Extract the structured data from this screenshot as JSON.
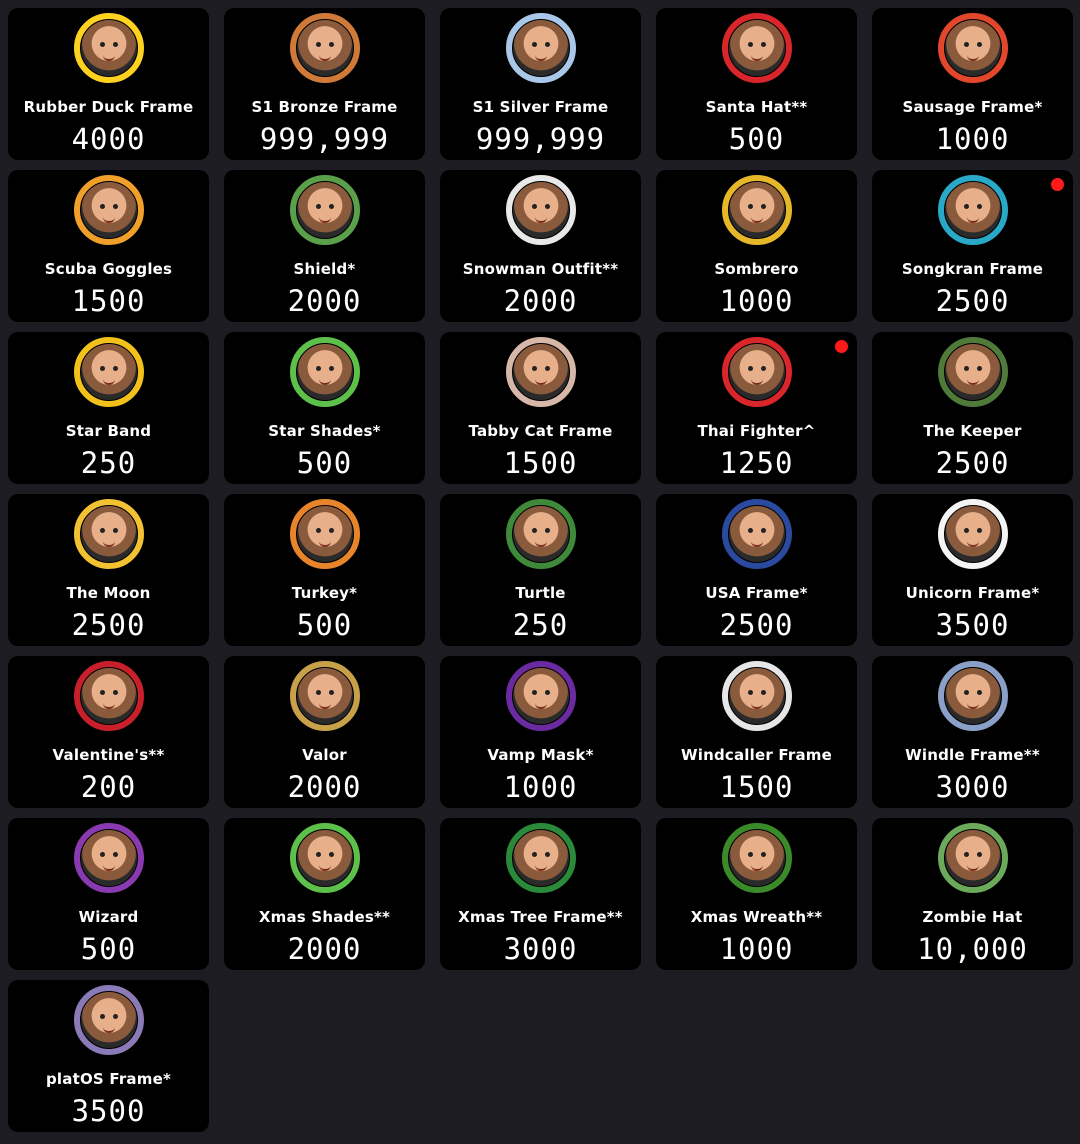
{
  "items": [
    {
      "name": "Rubber Duck Frame",
      "price": "4000",
      "icon": "rubber-duck-frame-icon",
      "ring": "#ffd21f",
      "badge": false
    },
    {
      "name": "S1 Bronze Frame",
      "price": "999,999",
      "icon": "bronze-frame-icon",
      "ring": "#d07a3a",
      "badge": false
    },
    {
      "name": "S1 Silver Frame",
      "price": "999,999",
      "icon": "silver-frame-icon",
      "ring": "#a9c7e8",
      "badge": false
    },
    {
      "name": "Santa Hat**",
      "price": "500",
      "icon": "santa-hat-icon",
      "ring": "#d8262b",
      "badge": false
    },
    {
      "name": "Sausage Frame*",
      "price": "1000",
      "icon": "sausage-frame-icon",
      "ring": "#e2472b",
      "badge": false
    },
    {
      "name": "Scuba Goggles",
      "price": "1500",
      "icon": "scuba-goggles-icon",
      "ring": "#f0a02a",
      "badge": false
    },
    {
      "name": "Shield*",
      "price": "2000",
      "icon": "shield-icon",
      "ring": "#5aa04a",
      "badge": false
    },
    {
      "name": "Snowman Outfit**",
      "price": "2000",
      "icon": "snowman-outfit-icon",
      "ring": "#e8e8e8",
      "badge": false
    },
    {
      "name": "Sombrero",
      "price": "1000",
      "icon": "sombrero-icon",
      "ring": "#e7b72a",
      "badge": false
    },
    {
      "name": "Songkran Frame",
      "price": "2500",
      "icon": "songkran-frame-icon",
      "ring": "#2aa8c8",
      "badge": true
    },
    {
      "name": "Star Band",
      "price": "250",
      "icon": "star-band-icon",
      "ring": "#f3c21a",
      "badge": false
    },
    {
      "name": "Star Shades*",
      "price": "500",
      "icon": "star-shades-icon",
      "ring": "#5cc04a",
      "badge": false
    },
    {
      "name": "Tabby Cat Frame",
      "price": "1500",
      "icon": "tabby-cat-frame-icon",
      "ring": "#d7b7a8",
      "badge": false
    },
    {
      "name": "Thai Fighter^",
      "price": "1250",
      "icon": "thai-fighter-icon",
      "ring": "#d8262b",
      "badge": true
    },
    {
      "name": "The Keeper",
      "price": "2500",
      "icon": "keeper-icon",
      "ring": "#4f7a3a",
      "badge": false
    },
    {
      "name": "The Moon",
      "price": "2500",
      "icon": "moon-icon",
      "ring": "#f2c232",
      "badge": false
    },
    {
      "name": "Turkey*",
      "price": "500",
      "icon": "turkey-icon",
      "ring": "#e8842a",
      "badge": false
    },
    {
      "name": "Turtle",
      "price": "250",
      "icon": "turtle-icon",
      "ring": "#3f8a3a",
      "badge": false
    },
    {
      "name": "USA Frame*",
      "price": "2500",
      "icon": "usa-frame-icon",
      "ring": "#2a4aa0",
      "badge": false
    },
    {
      "name": "Unicorn Frame*",
      "price": "3500",
      "icon": "unicorn-frame-icon",
      "ring": "#f4f4f4",
      "badge": false
    },
    {
      "name": "Valentine's**",
      "price": "200",
      "icon": "valentines-frame-icon",
      "ring": "#c8202a",
      "badge": false
    },
    {
      "name": "Valor",
      "price": "2000",
      "icon": "valor-icon",
      "ring": "#c8a04a",
      "badge": false
    },
    {
      "name": "Vamp Mask*",
      "price": "1000",
      "icon": "vamp-mask-icon",
      "ring": "#6a2aa0",
      "badge": false
    },
    {
      "name": "Windcaller Frame",
      "price": "1500",
      "icon": "windcaller-frame-icon",
      "ring": "#e6e6e6",
      "badge": false
    },
    {
      "name": "Windle Frame**",
      "price": "3000",
      "icon": "windle-frame-icon",
      "ring": "#8aa0c8",
      "badge": false
    },
    {
      "name": "Wizard",
      "price": "500",
      "icon": "wizard-hat-icon",
      "ring": "#8a3ab0",
      "badge": false
    },
    {
      "name": "Xmas Shades**",
      "price": "2000",
      "icon": "xmas-shades-icon",
      "ring": "#5cc04a",
      "badge": false
    },
    {
      "name": "Xmas Tree Frame**",
      "price": "3000",
      "icon": "xmas-tree-frame-icon",
      "ring": "#2a8a3a",
      "badge": false
    },
    {
      "name": "Xmas Wreath**",
      "price": "1000",
      "icon": "xmas-wreath-icon",
      "ring": "#3a8a2a",
      "badge": false
    },
    {
      "name": "Zombie Hat",
      "price": "10,000",
      "icon": "zombie-hat-icon",
      "ring": "#6aaa5a",
      "badge": false
    },
    {
      "name": "platOS Frame*",
      "price": "3500",
      "icon": "platos-frame-icon",
      "ring": "#8a7ab8",
      "badge": false
    }
  ]
}
